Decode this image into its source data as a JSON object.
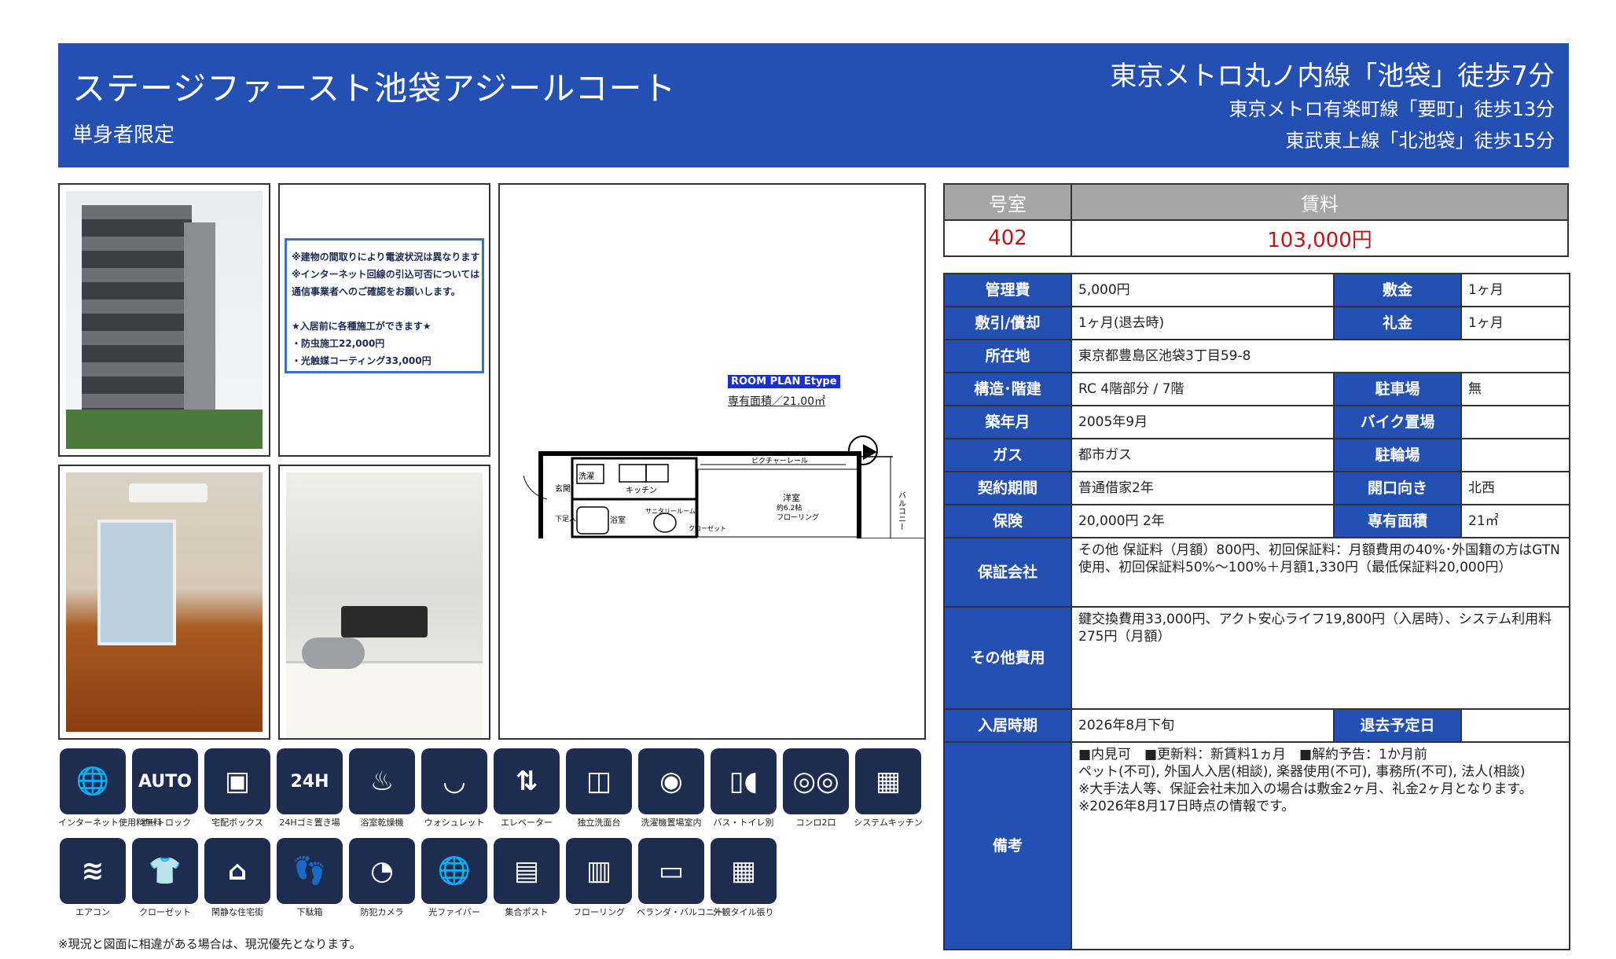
{
  "header": {
    "title": "ステージファースト池袋アジールコート",
    "subtitle": "単身者限定",
    "station1": "東京メトロ丸ノ内線「池袋」徒歩7分",
    "station2": "東京メトロ有楽町線「要町」徒歩13分",
    "station3": "東武東上線「北池袋」徒歩15分"
  },
  "notice": {
    "lines": [
      "※建物の間取りにより電波状況は異なります",
      "※インターネット回線の引込可否については",
      "通信事業者へのご確認をお願いします。",
      "",
      "★入居前に各種施工ができます★",
      "・防虫施工22,000円",
      "・光触媒コーティング33,000円"
    ]
  },
  "floorplan": {
    "title": "ROOM PLAN Etype",
    "area": "専有面積／21.00㎡",
    "labels": {
      "wash": "洗濯",
      "kitchen": "キッチン",
      "entrance": "玄関",
      "shoebox": "下足入",
      "bath": "浴室",
      "sanitary": "サニタリールーム",
      "closet": "クローゼット",
      "room": "洋室",
      "room_size": "約6.2帖",
      "flooring": "フローリング",
      "ceiling": "ピクチャーレール",
      "balcony": "バルコニー"
    }
  },
  "price": {
    "room_header": "号室",
    "rent_header": "賃料",
    "room": "402",
    "rent": "103,000円"
  },
  "details": {
    "kanrihi_label": "管理費",
    "kanrihi": "5,000円",
    "shikikin_label": "敷金",
    "shikikin": "1ヶ月",
    "shikibiki_label": "敷引/償却",
    "shikibiki": "1ヶ月(退去時)",
    "reikin_label": "礼金",
    "reikin": "1ヶ月",
    "address_label": "所在地",
    "address": "東京都豊島区池袋3丁目59-8",
    "structure_label": "構造･階建",
    "structure": "RC 4階部分 / 7階",
    "parking_label": "駐車場",
    "parking": "無",
    "built_label": "築年月",
    "built": "2005年9月",
    "bike_label": "バイク置場",
    "bike": "",
    "gas_label": "ガス",
    "gas": "都市ガス",
    "bicycle_label": "駐輪場",
    "bicycle": "",
    "contract_label": "契約期間",
    "contract": "普通借家2年",
    "direction_label": "開口向き",
    "direction": "北西",
    "insurance_label": "保険",
    "insurance": "20,000円 2年",
    "area_label": "専有面積",
    "area": "21㎡",
    "guarantor_label": "保証会社",
    "guarantor": "その他 保証料（月額）800円、初回保証料：月額費用の40%･外国籍の方はGTN使用、初回保証料50%〜100%＋月額1,330円（最低保証料20,000円）",
    "other_label": "その他費用",
    "other": "鍵交換費用33,000円、アクト安心ライフ19,800円（入居時）、システム利用料275円（月額）",
    "movein_label": "入居時期",
    "movein": "2026年8月下旬",
    "moveout_label": "退去予定日",
    "moveout": "",
    "remarks_label": "備考",
    "remarks": [
      "■内見可　■更新料：新賃料1ヵ月　■解約予告：1か月前",
      "ペット(不可), 外国人入居(相談), 楽器使用(不可), 事務所(不可), 法人(相談)",
      "※大手法人等、保証会社未加入の場合は敷金2ヶ月、礼金2ヶ月となります。",
      "※2026年8月17日時点の情報です。"
    ]
  },
  "icons": [
    {
      "label": "インターネット使用料無料",
      "glyph": "🌐",
      "name": "internet-free-icon"
    },
    {
      "label": "オートロック",
      "glyph": "AUTO",
      "name": "autolock-icon"
    },
    {
      "label": "宅配ボックス",
      "glyph": "▣",
      "name": "delivery-box-icon"
    },
    {
      "label": "24Hゴミ置き場",
      "glyph": "24H",
      "name": "garbage-24h-icon"
    },
    {
      "label": "浴室乾燥機",
      "glyph": "♨",
      "name": "bath-dryer-icon"
    },
    {
      "label": "ウォシュレット",
      "glyph": "◡",
      "name": "washlet-icon"
    },
    {
      "label": "エレベーター",
      "glyph": "⇅",
      "name": "elevator-icon"
    },
    {
      "label": "独立洗面台",
      "glyph": "◫",
      "name": "vanity-icon"
    },
    {
      "label": "洗濯機置場室内",
      "glyph": "◉",
      "name": "washer-space-icon"
    },
    {
      "label": "バス・トイレ別",
      "glyph": "▯◖",
      "name": "bath-toilet-separate-icon"
    },
    {
      "label": "コンロ2口",
      "glyph": "◎◎",
      "name": "stove-2-icon"
    },
    {
      "label": "システムキッチン",
      "glyph": "▦",
      "name": "system-kitchen-icon"
    },
    {
      "label": "エアコン",
      "glyph": "≋",
      "name": "aircon-icon"
    },
    {
      "label": "クローゼット",
      "glyph": "👕",
      "name": "closet-icon"
    },
    {
      "label": "閑静な住宅街",
      "glyph": "⌂",
      "name": "quiet-area-icon"
    },
    {
      "label": "下駄箱",
      "glyph": "👣",
      "name": "shoe-box-icon"
    },
    {
      "label": "防犯カメラ",
      "glyph": "◔",
      "name": "security-camera-icon"
    },
    {
      "label": "光ファイバー",
      "glyph": "🌐",
      "name": "fiber-icon"
    },
    {
      "label": "集合ポスト",
      "glyph": "▤",
      "name": "mailbox-icon"
    },
    {
      "label": "フローリング",
      "glyph": "▥",
      "name": "flooring-icon"
    },
    {
      "label": "ベランダ・バルコニー",
      "glyph": "▭",
      "name": "balcony-icon"
    },
    {
      "label": "外観タイル張り",
      "glyph": "▦",
      "name": "tile-exterior-icon"
    }
  ],
  "footnote": "※現況と図面に相違がある場合は、現況優先となります。",
  "colors": {
    "header_bg": "#2550b3",
    "label_bg": "#2550b3",
    "rent_red": "#c0141c",
    "icon_bg": "#1e2d4f",
    "price_header_bg": "#a6a6a6"
  }
}
